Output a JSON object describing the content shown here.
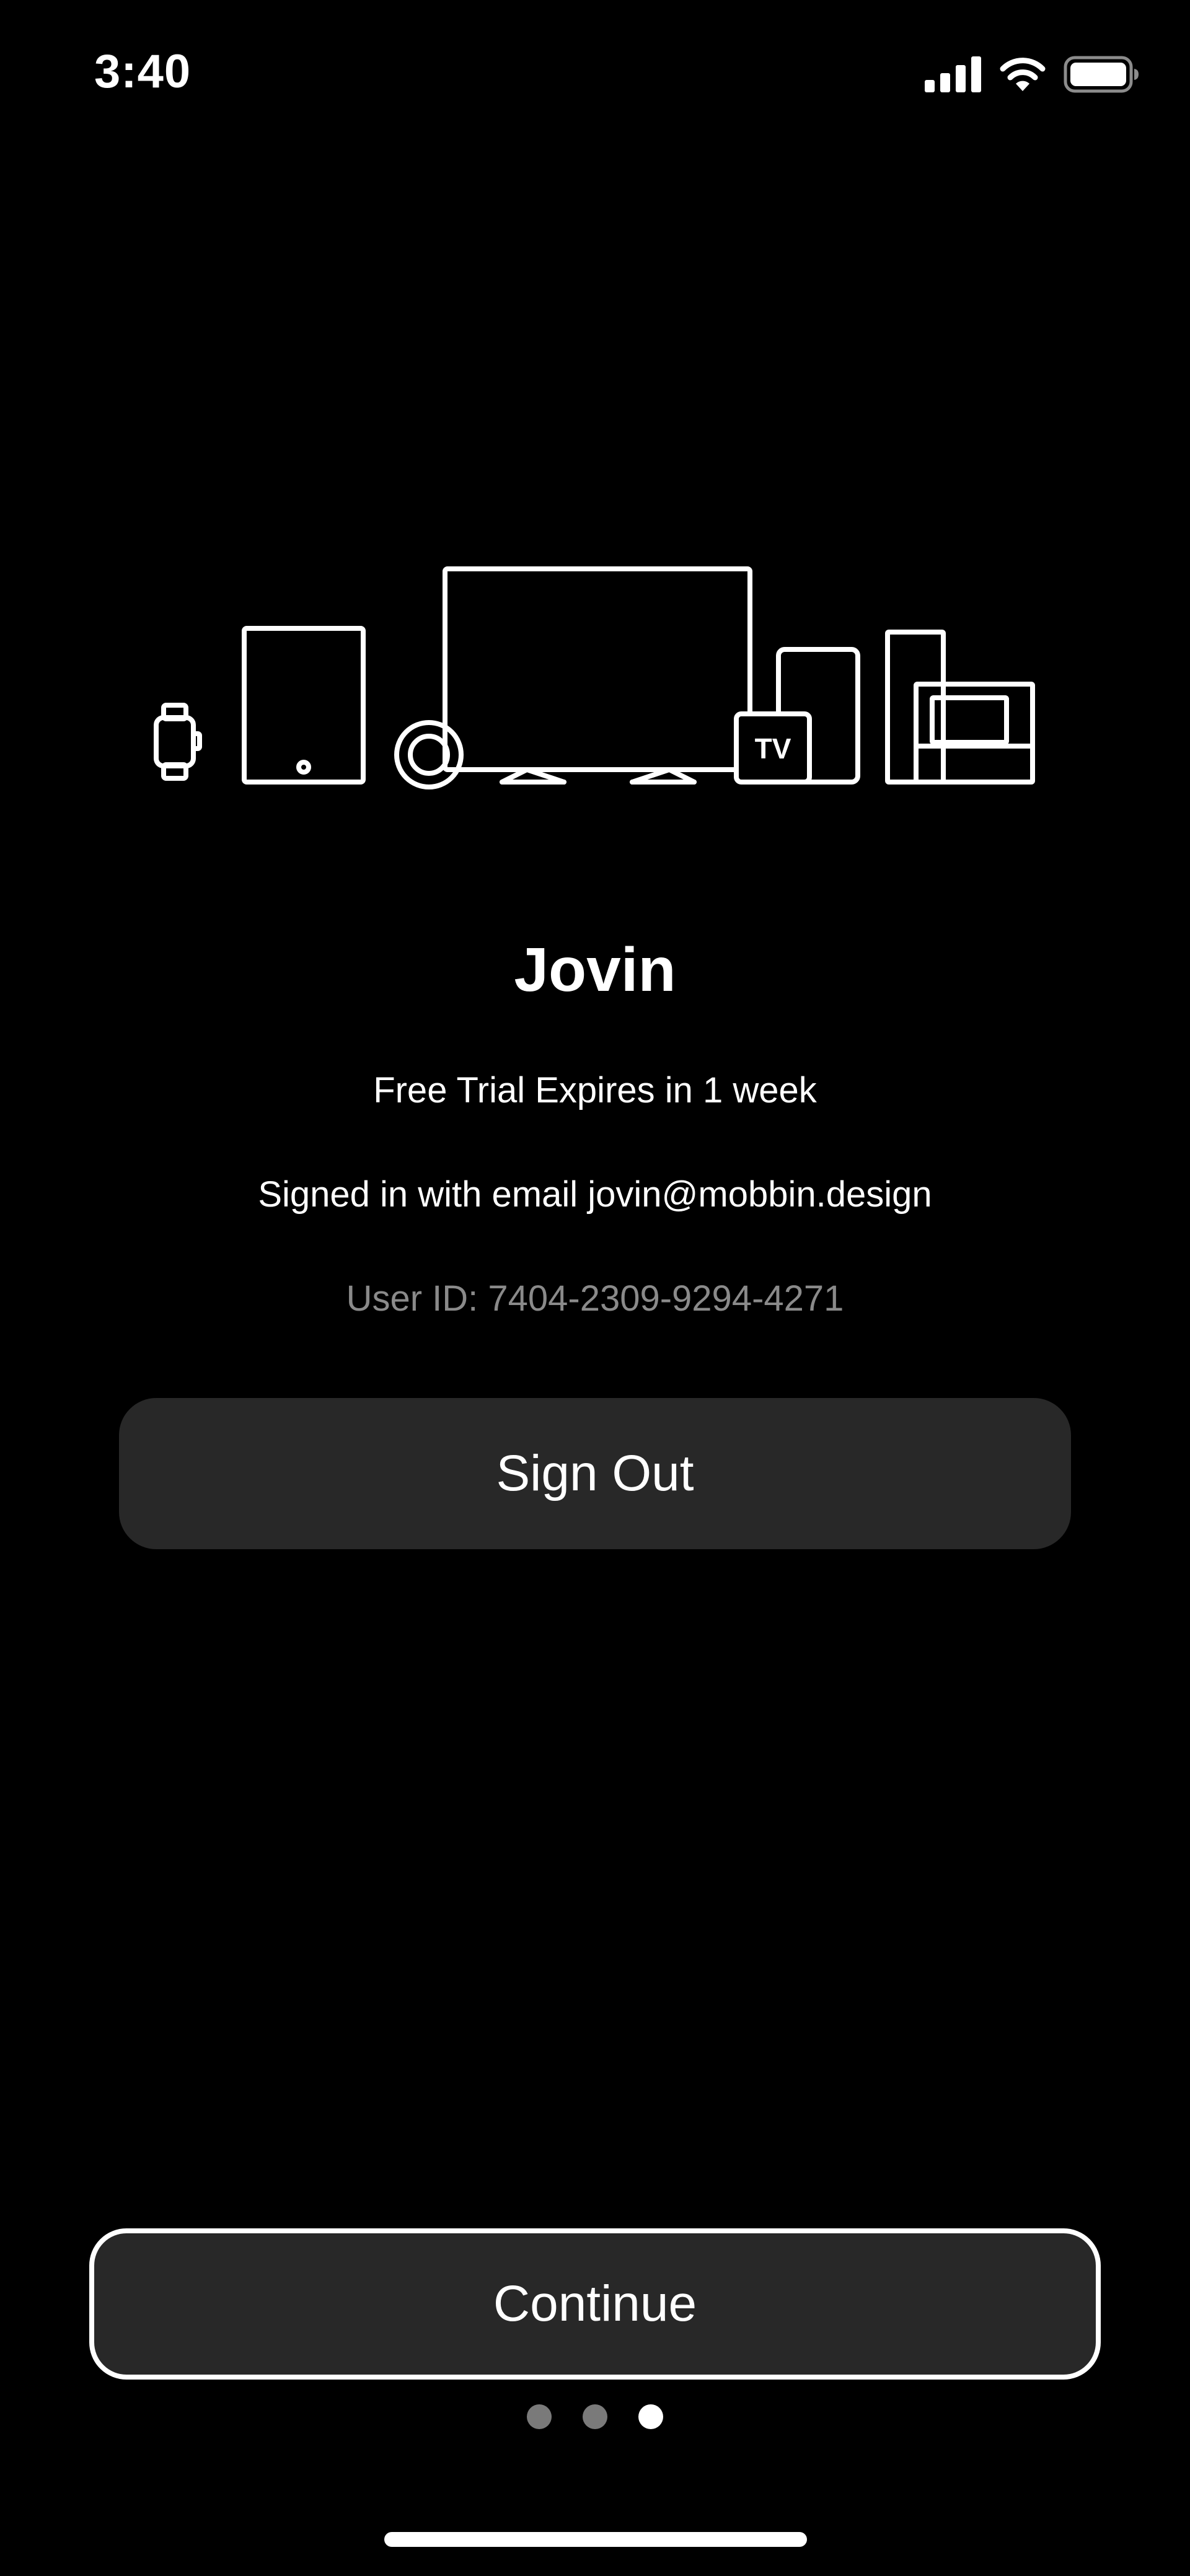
{
  "status_bar": {
    "time": "3:40",
    "icons": [
      "cellular-signal-icon",
      "wifi-icon",
      "battery-icon"
    ]
  },
  "illustration": {
    "icons": [
      "watch-icon",
      "tablet-icon",
      "speaker-icon",
      "tv-icon",
      "tv-box-icon",
      "phone-icon",
      "console-icon"
    ],
    "tv_box_label": "TV"
  },
  "profile": {
    "name": "Jovin",
    "trial": "Free Trial Expires in 1 week",
    "email_line": "Signed in with email jovin@mobbin.design",
    "user_id": "User ID: 7404-2309-9294-4271"
  },
  "actions": {
    "sign_out_label": "Sign Out",
    "continue_label": "Continue"
  },
  "pager": {
    "total": 3,
    "current": 3
  },
  "colors": {
    "background": "#000000",
    "button_fill": "#282828",
    "muted_text": "#8a8a8a",
    "dot_inactive": "#7a7a7a",
    "foreground": "#ffffff"
  }
}
